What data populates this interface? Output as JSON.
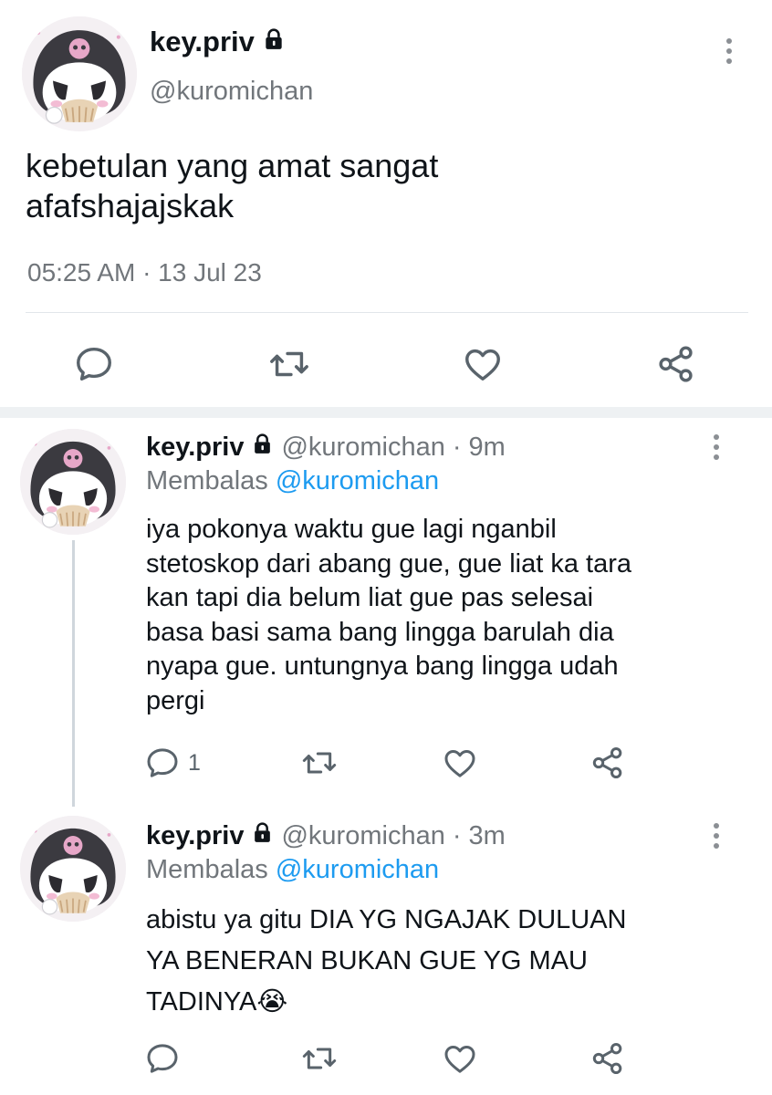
{
  "main_tweet": {
    "display_name": "key.priv",
    "handle": "@kuromichan",
    "text_line1": "kebetulan yang amat sangat",
    "text_line2": "afafshajajskak",
    "timestamp": "05:25 AM · 13 Jul 23"
  },
  "replies": [
    {
      "display_name": "key.priv",
      "handle": "@kuromichan",
      "time": "· 9m",
      "reply_prefix": "Membalas",
      "reply_to": "@kuromichan",
      "lines": [
        "iya pokonya waktu gue lagi nganbil",
        "stetoskop dari abang gue, gue liat ka tara",
        "kan tapi dia belum liat gue pas selesai",
        "basa basi sama bang lingga barulah dia",
        "nyapa gue. untungnya bang lingga udah",
        "pergi"
      ],
      "reply_count": "1"
    },
    {
      "display_name": "key.priv",
      "handle": "@kuromichan",
      "time": "· 3m",
      "reply_prefix": "Membalas",
      "reply_to": "@kuromichan",
      "lines": [
        "abistu ya gitu DIA YG NGAJAK DULUAN",
        "YA BENERAN BUKAN GUE YG MAU",
        "TADINYA😭"
      ],
      "reply_count": ""
    }
  ],
  "icons": {
    "reply": "reply-icon",
    "retweet": "retweet-icon",
    "like": "like-icon",
    "share": "share-icon",
    "more": "more-icon",
    "lock": "lock-icon"
  },
  "colors": {
    "link": "#1d9bf0",
    "muted": "#71767b",
    "icon": "#59636b"
  }
}
